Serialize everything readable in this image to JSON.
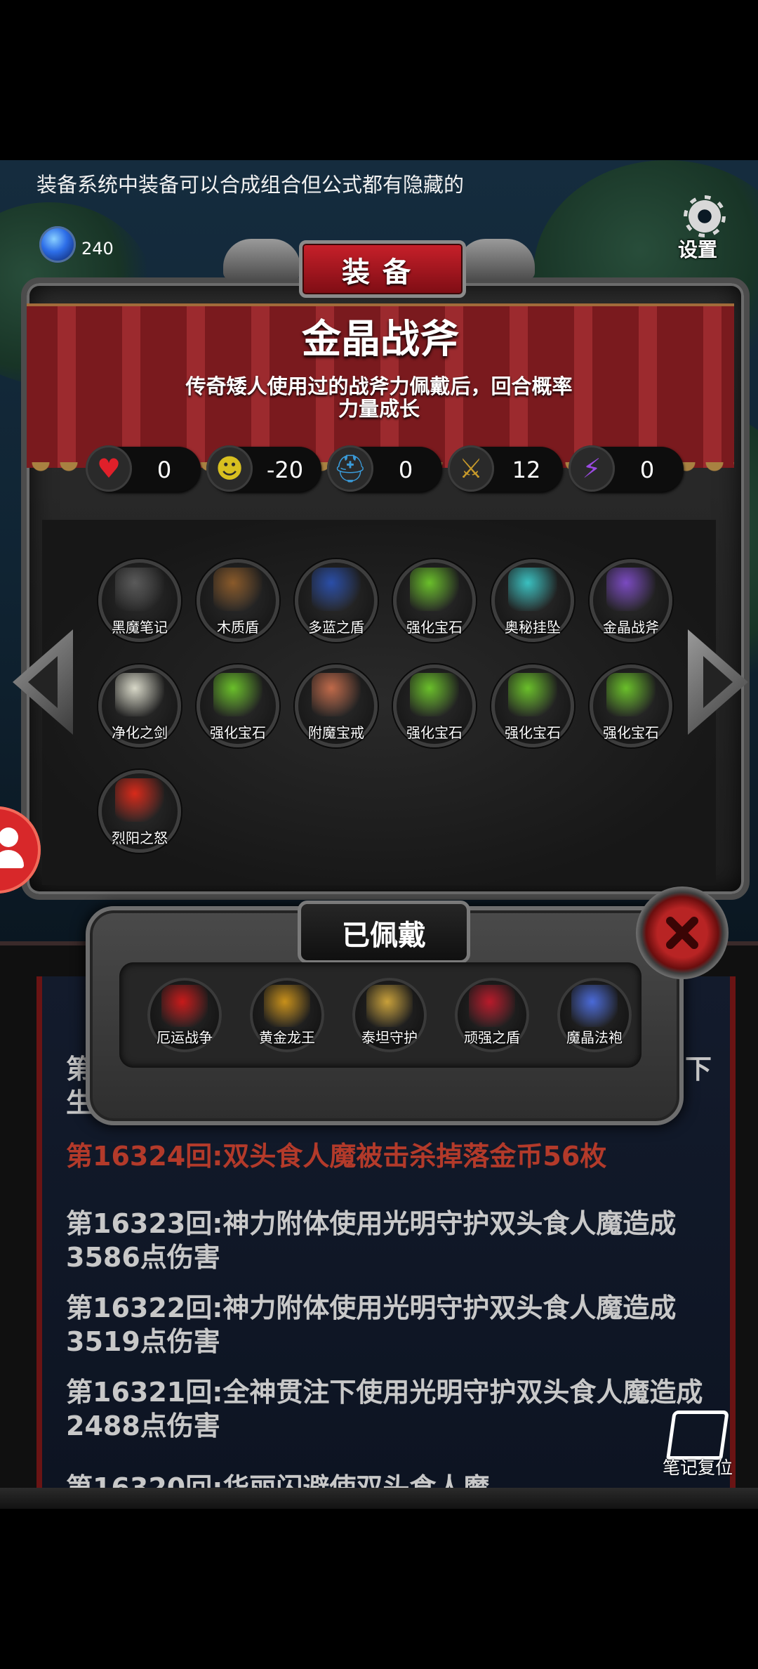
{
  "hint": "装备系统中装备可以合成组合但公式都有隐藏的",
  "gems": "240",
  "settings_label": "设置",
  "header_title": "装备",
  "item": {
    "name": "金晶战斧",
    "description": "传奇矮人使用过的战斧力佩戴后，回合概率力量成长"
  },
  "stats": [
    {
      "icon": "heart-icon",
      "value": "0"
    },
    {
      "icon": "strength-icon",
      "value": "-20"
    },
    {
      "icon": "helmet-icon",
      "value": "0"
    },
    {
      "icon": "sword-icon",
      "value": "12"
    },
    {
      "icon": "lightning-icon",
      "value": "0"
    }
  ],
  "inventory": [
    {
      "name": "黑魔笔记",
      "color": "#5a5a5a"
    },
    {
      "name": "木质盾",
      "color": "#8a5a2a"
    },
    {
      "name": "多蓝之盾",
      "color": "#2a4ea8"
    },
    {
      "name": "强化宝石",
      "color": "#6abf2a"
    },
    {
      "name": "奥秘挂坠",
      "color": "#3ac0c0"
    },
    {
      "name": "金晶战斧",
      "color": "#7a4ac0"
    },
    {
      "name": "净化之剑",
      "color": "#d8d8c8"
    },
    {
      "name": "强化宝石",
      "color": "#6abf2a"
    },
    {
      "name": "附魔宝戒",
      "color": "#c06a4a"
    },
    {
      "name": "强化宝石",
      "color": "#6abf2a"
    },
    {
      "name": "强化宝石",
      "color": "#6abf2a"
    },
    {
      "name": "强化宝石",
      "color": "#6abf2a"
    },
    {
      "name": "烈阳之怒",
      "color": "#d82a1a"
    }
  ],
  "equipped": {
    "title": "已佩戴",
    "items": [
      {
        "name": "厄运战争",
        "color": "#c81a1a"
      },
      {
        "name": "黄金龙王",
        "color": "#c8901a"
      },
      {
        "name": "泰坦守护",
        "color": "#c8a03a"
      },
      {
        "name": "顽强之盾",
        "color": "#b81a2a"
      },
      {
        "name": "魔晶法袍",
        "color": "#4a6ad8"
      }
    ]
  },
  "log": {
    "partial_line_1": "第",
    "partial_line_2": "生",
    "partial_right": "下",
    "lines": [
      {
        "text": "第16324回:双头食人魔被击杀掉落金币56枚",
        "style": "red"
      },
      {
        "text": "第16323回:神力附体使用光明守护双头食人魔造成3586点伤害",
        "style": "normal"
      },
      {
        "text": "第16322回:神力附体使用光明守护双头食人魔造成3519点伤害",
        "style": "normal"
      },
      {
        "text": "第16321回:全神贯注下使用光明守护双头食人魔造成2488点伤害",
        "style": "normal"
      },
      {
        "text": "第16320回:华丽闪避使双头食人魔",
        "style": "normal"
      }
    ]
  },
  "note_reset_label": "笔记复位",
  "colors": {
    "accent_red": "#c8202a",
    "log_red": "#b33a2a",
    "panel_dark": "#1e1e1e"
  }
}
